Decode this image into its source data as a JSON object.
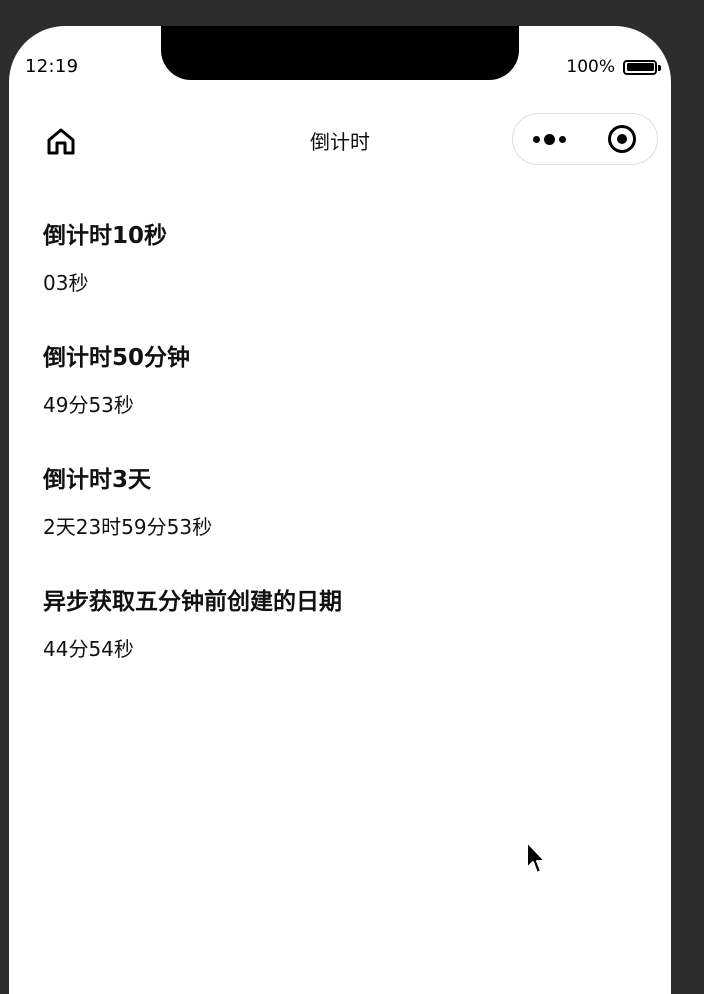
{
  "status_bar": {
    "time": "12:19",
    "battery_percent": "100%"
  },
  "nav_bar": {
    "title": "倒计时"
  },
  "sections": [
    {
      "title": "倒计时10秒",
      "value": "03秒"
    },
    {
      "title": "倒计时50分钟",
      "value": "49分53秒"
    },
    {
      "title": "倒计时3天",
      "value": "2天23时59分53秒"
    },
    {
      "title": "异步获取五分钟前创建的日期",
      "value": "44分54秒"
    }
  ],
  "icons": {
    "home": "home-icon",
    "more": "more-dots-icon",
    "close": "close-target-icon",
    "battery": "battery-icon",
    "cursor": "mouse-cursor-icon"
  }
}
